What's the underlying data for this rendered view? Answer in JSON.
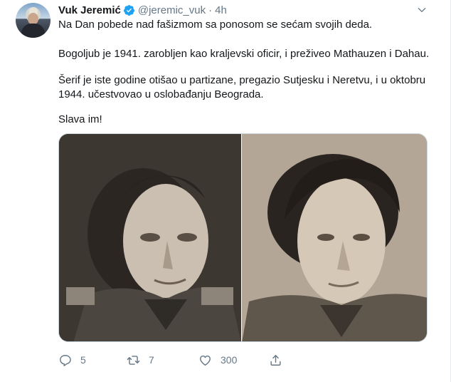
{
  "tweet": {
    "author_name": "Vuk Jeremić",
    "handle": "@jeremic_vuk",
    "separator": "·",
    "time": "4h",
    "paragraphs": [
      "Na Dan pobede nad fašizmom sa ponosom se sećam svojih deda.",
      "Bogoljub je 1941. zarobljen kao kraljevski oficir, i preživeo Mathauzen i Dahau.",
      "Šerif je iste godine otišao u partizane, pregazio Sutjesku i Neretvu, i u oktobru 1944. učestvovao u oslobađanju Beograda.",
      "Slava im!"
    ],
    "media": {
      "photo_count": 2
    },
    "actions": {
      "replies": "5",
      "retweets": "7",
      "likes": "300"
    }
  },
  "icons": {
    "verified": "verified-badge-icon",
    "caret": "chevron-down-icon",
    "reply": "reply-icon",
    "retweet": "retweet-icon",
    "like": "heart-icon",
    "share": "share-icon"
  },
  "colors": {
    "text": "#14171a",
    "muted": "#657786",
    "verified": "#1da1f2",
    "border": "#ccd6dd"
  }
}
